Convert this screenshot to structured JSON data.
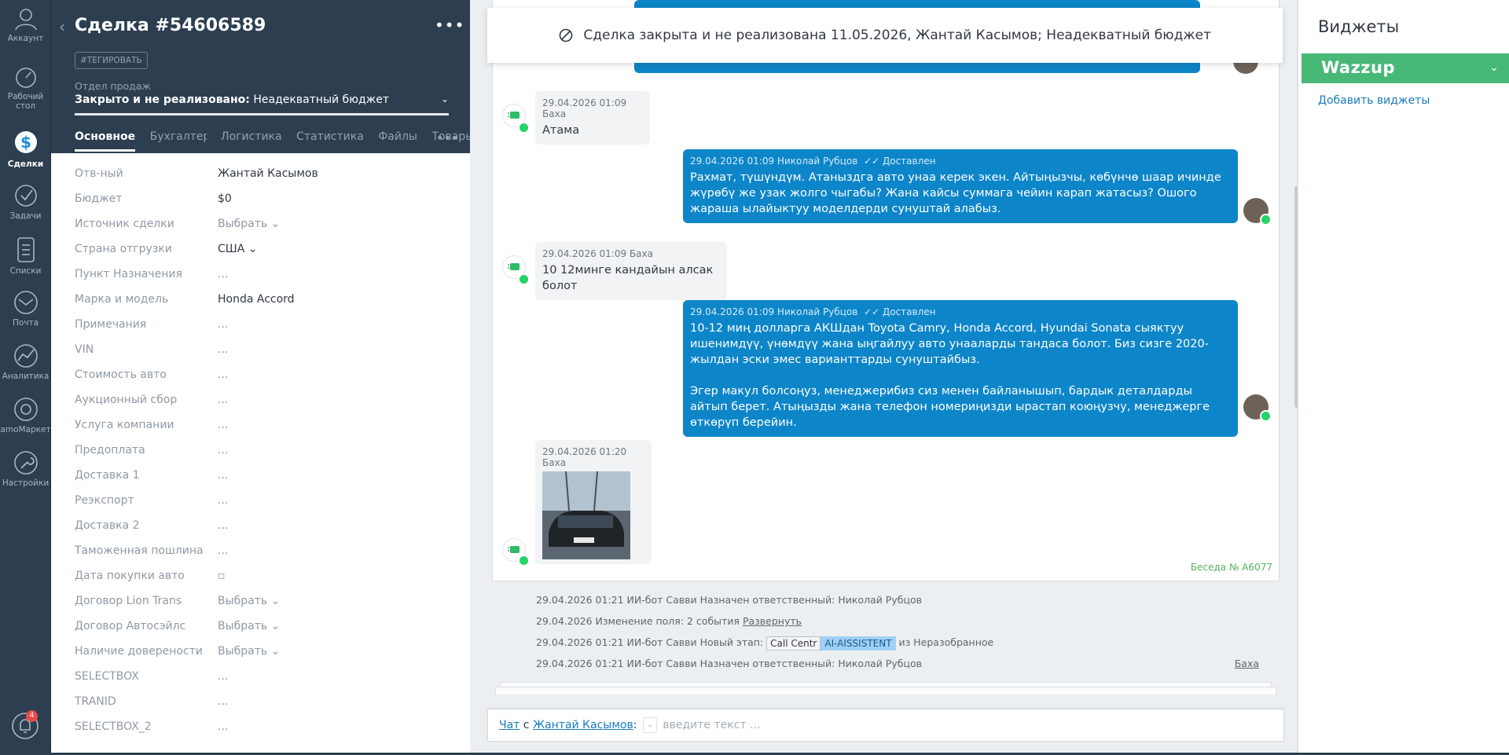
{
  "nav": {
    "account": "Аккаунт",
    "dashboard_line1": "Рабочий",
    "dashboard_line2": "стол",
    "deals": "Сделки",
    "tasks": "Задачи",
    "lists": "Списки",
    "mail": "Почта",
    "analytics": "Аналитика",
    "market": "amoМаркет",
    "settings": "Настройки",
    "notifications_count": "4"
  },
  "card": {
    "back": "‹",
    "title": "Сделка #54606589",
    "more": "•••",
    "tag_button": "#ТЕГИРОВАТЬ",
    "pipeline": "Отдел продаж",
    "status_bold": "Закрыто и не реализовано:",
    "status_reason": "Неадекватный бюджет",
    "tabs": [
      "Основное",
      "Бухгалтерия",
      "Логистика",
      "Статистика",
      "Файлы",
      "Товары"
    ],
    "tabs_more": "•••",
    "fields": [
      {
        "label": "Отв-ный",
        "value": "Жантай Касымов"
      },
      {
        "label": "Бюджет",
        "value": "$0"
      },
      {
        "label": "Источник сделки",
        "value": "Выбрать ⌄"
      },
      {
        "label": "Страна отгрузки",
        "value": "США ⌄"
      },
      {
        "label": "Пункт Назначения",
        "value": "..."
      },
      {
        "label": "Марка и модель",
        "value": "Honda Accord"
      },
      {
        "label": "Примечания",
        "value": "..."
      },
      {
        "label": "VIN",
        "value": "..."
      },
      {
        "label": "Стоимость авто",
        "value": "..."
      },
      {
        "label": "Аукционный сбор",
        "value": "..."
      },
      {
        "label": "Услуга компании",
        "value": "..."
      },
      {
        "label": "Предоплата",
        "value": "..."
      },
      {
        "label": "Доставка 1",
        "value": "..."
      },
      {
        "label": "Реэкспорт",
        "value": "..."
      },
      {
        "label": "Доставка 2",
        "value": "..."
      },
      {
        "label": "Таможенная пошлина",
        "value": "..."
      },
      {
        "label": "Дата покупки авто",
        "value": "▫"
      },
      {
        "label": "Договор Lion Trans",
        "value": "Выбрать ⌄"
      },
      {
        "label": "Договор Автосэйлс",
        "value": "Выбрать ⌄"
      },
      {
        "label": "Наличие доверености",
        "value": "Выбрать ⌄"
      },
      {
        "label": "SELECTBOX",
        "value": "..."
      },
      {
        "label": "TRANID",
        "value": "..."
      },
      {
        "label": "SELECTBOX_2",
        "value": "..."
      }
    ]
  },
  "banner": {
    "text": "Сделка закрыта и не реализована 11.05.2026, Жантай Касымов; Неадекватный бюджет"
  },
  "messages": [
    {
      "meta": "29.04.2026 01:09 Баха",
      "text": "Атама"
    },
    {
      "meta": "29.04.2026 01:09 Николай Рубцов",
      "delivered": "✓✓ Доставлен",
      "text": "Рахмат, түшүндүм. Атаныздга авто унаа керек экен. Айтыңызчы, көбүнчө шаар ичинде жүрөбү же узак жолго чыгабы? Жана кайсы суммага чейин карап жатасыз? Ошого жараша ылайыктуу моделдерди сунуштай алабыз."
    },
    {
      "meta": "29.04.2026 01:09 Баха",
      "text": "10 12минге кандайын алсак болот"
    },
    {
      "meta": "29.04.2026 01:09 Николай Рубцов",
      "delivered": "✓✓ Доставлен",
      "text": "10-12 миң долларга АКШдан Toyota Camry, Honda Accord, Hyundai Sonata сыяктуу ишенимдүү, үнөмдүү жана ыңгайлуу авто унааларды тандаса болот. Биз сизге 2020-жылдан эски эмес варианттарды сунуштайбыз.",
      "text2": "Эгер макул болсоңуз, менеджерибиз сиз менен байланышып, бардык деталдарды айтып берет. Атыңызды жана телефон номериңизди ырастап коюңузчу, менеджерге өткөрүп берейин."
    },
    {
      "meta": "29.04.2026 01:20 Баха",
      "text": ""
    }
  ],
  "conversation_number": "Беседа № A6077",
  "events": [
    {
      "text": "29.04.2026 01:21 ИИ-бот Савви Назначен ответственный: Николай Рубцов"
    },
    {
      "text": "29.04.2026 Изменение поля: 2 события",
      "link": "Развернуть"
    },
    {
      "prefix": "29.04.2026 01:21 ИИ-бот Савви Новый этап:",
      "chip1": "Call Centr",
      "chip2": "AI-AISSISTENT",
      "suffix": "из Неразобранное"
    },
    {
      "text": "29.04.2026 01:21 ИИ-бот Савви Назначен ответственный: Николай Рубцов",
      "right_link": "Баха"
    }
  ],
  "chat": {
    "chat_link": "Чат",
    "with": "с",
    "contact": "Жантай Касымов",
    "colon": ":",
    "placeholder": "введите текст ..."
  },
  "widgets": {
    "title": "Виджеты",
    "wazzup": "Wazzup",
    "add": "Добавить виджеты"
  },
  "colors": {
    "nav_bg": "#2c3e50",
    "out_bubble": "#0d85c9",
    "wazzup_green": "#48b877",
    "whatsapp_green": "#25d366"
  }
}
